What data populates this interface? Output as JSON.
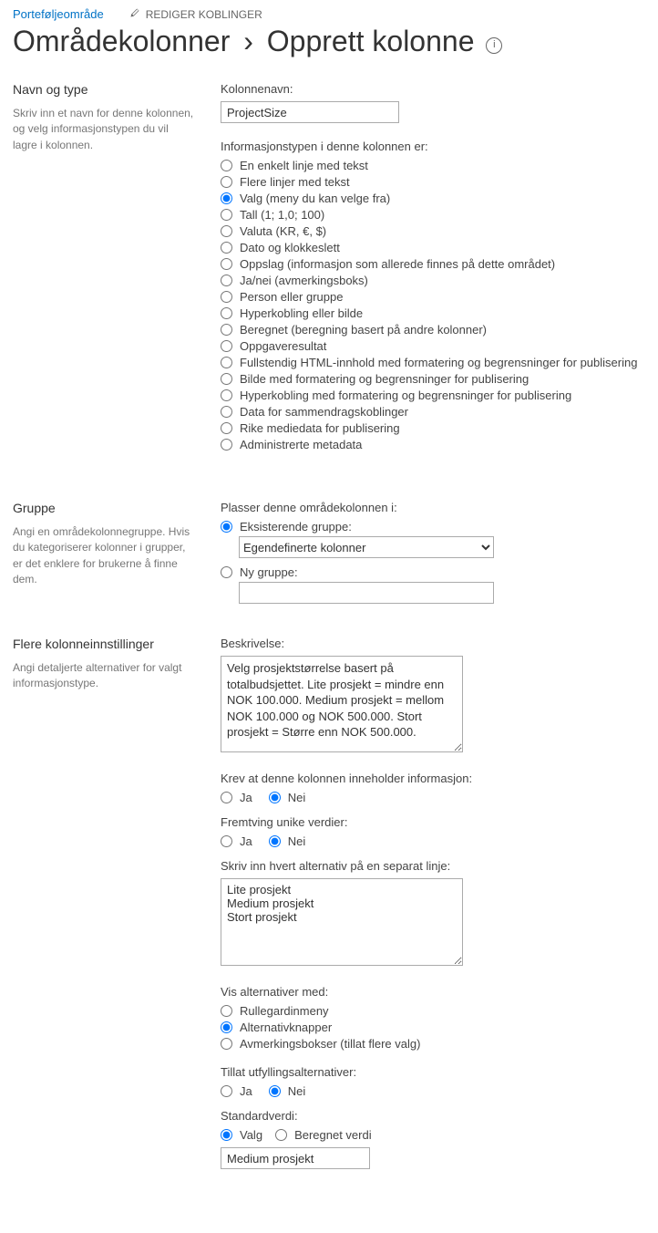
{
  "nav": {
    "portfolio_area": "Porteføljeområde",
    "edit_links": "REDIGER KOBLINGER"
  },
  "title": {
    "part1": "Områdekolonner",
    "sep": "›",
    "part2": "Opprett kolonne"
  },
  "section1": {
    "title": "Navn og type",
    "desc": "Skriv inn et navn for denne kolonnen, og velg informasjonstypen du vil lagre i kolonnen.",
    "column_name_label": "Kolonnenavn:",
    "column_name_value": "ProjectSize",
    "info_type_label": "Informasjonstypen i denne kolonnen er:",
    "types": [
      "En enkelt linje med tekst",
      "Flere linjer med tekst",
      "Valg (meny du kan velge fra)",
      "Tall (1; 1,0; 100)",
      "Valuta (KR, €, $)",
      "Dato og klokkeslett",
      "Oppslag (informasjon som allerede finnes på dette området)",
      "Ja/nei (avmerkingsboks)",
      "Person eller gruppe",
      "Hyperkobling eller bilde",
      "Beregnet (beregning basert på andre kolonner)",
      "Oppgaveresultat",
      "Fullstendig HTML-innhold med formatering og begrensninger for publisering",
      "Bilde med formatering og begrensninger for publisering",
      "Hyperkobling med formatering og begrensninger for publisering",
      "Data for sammendragskoblinger",
      "Rike mediedata for publisering",
      "Administrerte metadata"
    ],
    "selected_type_index": 2
  },
  "section2": {
    "title": "Gruppe",
    "desc": "Angi en områdekolonnegruppe. Hvis du kategoriserer kolonner i grupper, er det enklere for brukerne å finne dem.",
    "place_label": "Plasser denne områdekolonnen i:",
    "existing_group_label": "Eksisterende gruppe:",
    "existing_group_value": "Egendefinerte kolonner",
    "new_group_label": "Ny gruppe:",
    "new_group_value": "",
    "group_mode_existing": true
  },
  "section3": {
    "title": "Flere kolonneinnstillinger",
    "left_desc": "Angi detaljerte alternativer for valgt informasjonstype.",
    "desc_label": "Beskrivelse:",
    "desc_value": "Velg prosjektstørrelse basert på totalbudsjettet. Lite prosjekt = mindre enn NOK 100.000. Medium prosjekt = mellom NOK 100.000 og NOK 500.000. Stort prosjekt = Større enn NOK 500.000.",
    "require_label": "Krev at denne kolonnen inneholder informasjon:",
    "yes": "Ja",
    "no": "Nei",
    "require_value": "Nei",
    "unique_label": "Fremtving unike verdier:",
    "unique_value": "Nei",
    "choices_label": "Skriv inn hvert alternativ på en separat linje:",
    "choices_value": "Lite prosjekt\nMedium prosjekt\nStort prosjekt",
    "display_label": "Vis alternativer med:",
    "display_options": [
      "Rullegardinmeny",
      "Alternativknapper",
      "Avmerkingsbokser (tillat flere valg)"
    ],
    "display_selected": 1,
    "fillin_label": "Tillat utfyllingsalternativer:",
    "fillin_value": "Nei",
    "default_label": "Standardverdi:",
    "default_mode_options": [
      "Valg",
      "Beregnet verdi"
    ],
    "default_mode_selected": 0,
    "default_value": "Medium prosjekt"
  }
}
